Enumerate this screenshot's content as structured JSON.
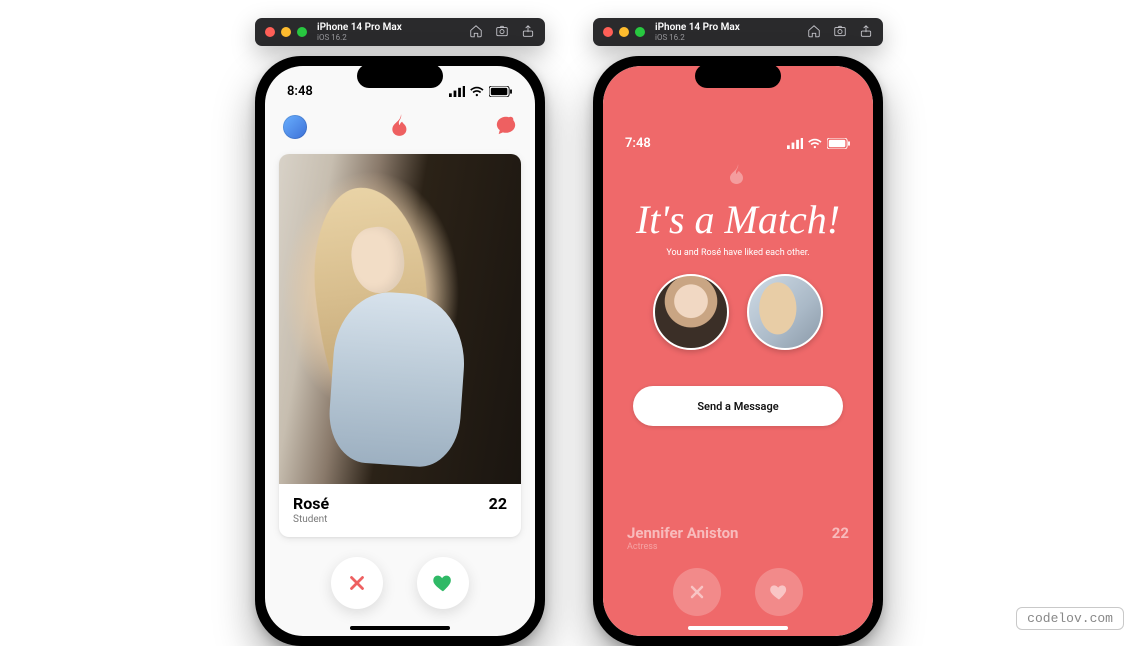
{
  "simulator": {
    "device_name": "iPhone 14 Pro Max",
    "os": "iOS 16.2"
  },
  "phoneA": {
    "time": "8:48",
    "card": {
      "name": "Rosé",
      "role": "Student",
      "age": "22"
    }
  },
  "phoneB": {
    "time": "7:48",
    "match": {
      "title": "It's a Match!",
      "subtitle": "You and Rosé have liked each other.",
      "button": "Send a Message"
    },
    "bg_card": {
      "name": "Jennifer Aniston",
      "role": "Actress",
      "age": "22"
    }
  },
  "colors": {
    "brand": "#ee6061",
    "like": "#2fb966",
    "nope": "#ee6061"
  },
  "watermark": "codelov.com"
}
